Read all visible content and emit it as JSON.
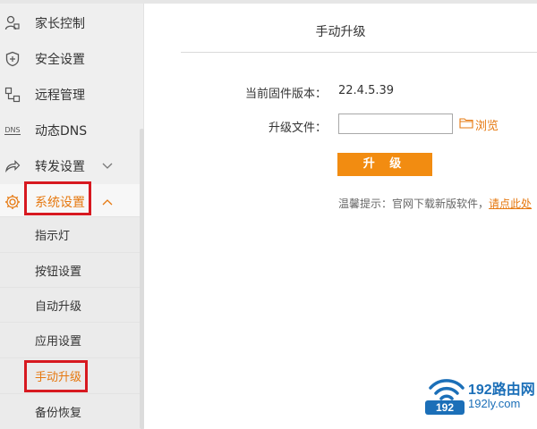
{
  "sidebar": {
    "items": [
      {
        "label": "家长控制",
        "icon": "user-shield-icon"
      },
      {
        "label": "安全设置",
        "icon": "shield-icon"
      },
      {
        "label": "远程管理",
        "icon": "remote-icon"
      },
      {
        "label": "动态DNS",
        "icon": "dns-icon",
        "icon_text": "DNS"
      },
      {
        "label": "转发设置",
        "icon": "forward-icon"
      },
      {
        "label": "系统设置",
        "icon": "gear-icon"
      }
    ],
    "sub_items": [
      {
        "label": "指示灯"
      },
      {
        "label": "按钮设置"
      },
      {
        "label": "自动升级"
      },
      {
        "label": "应用设置"
      },
      {
        "label": "手动升级"
      },
      {
        "label": "备份恢复"
      }
    ]
  },
  "main": {
    "title": "手动升级",
    "firmware_label": "当前固件版本：",
    "firmware_version": "22.4.5.39",
    "file_label": "升级文件：",
    "file_value": "",
    "browse_label": "浏览",
    "upgrade_button": "升 级",
    "tip_prefix": "温馨提示：官网下载新版软件，",
    "tip_link": "请点此处"
  },
  "watermark": {
    "brand": "192路由网",
    "domain": "192ly.com",
    "badge": "192"
  },
  "colors": {
    "accent": "#e6780f",
    "button": "#f28c11",
    "highlight": "#d71920",
    "watermark": "#1b6fb8"
  }
}
